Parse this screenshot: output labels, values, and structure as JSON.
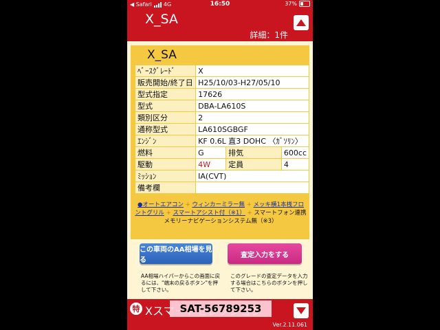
{
  "status_bar": {
    "carrier": "◀ Safari",
    "network": "4G",
    "time": "16:50",
    "battery": "37%"
  },
  "header": {
    "title": "X_SA",
    "detail": "詳細：1件",
    "accent_color": "#c8151f"
  },
  "card": {
    "title": "X_SA",
    "rows": [
      {
        "label": "ﾍﾞｰｽｸﾞﾚｰﾄﾞ",
        "value": "X"
      },
      {
        "label": "販売開始/終了日",
        "value": "H25/10/03-H27/05/10"
      },
      {
        "label": "型式指定",
        "value": "17626"
      },
      {
        "label": "型式",
        "value": "DBA-LA610S"
      },
      {
        "label": "類別区分",
        "value": "2"
      },
      {
        "label": "通称型式",
        "value": "LA610SGBGF"
      },
      {
        "label": "ｴﾝｼﾞﾝ",
        "value": "KF 0.6L 直3 DOHC 〈ｶﾞｿﾘﾝ〉"
      }
    ],
    "fuel": {
      "label": "燃料",
      "value": "G",
      "label2": "排気",
      "value2": "600cc"
    },
    "drive": {
      "label": "駆動",
      "value": "4W",
      "label2": "定員",
      "value2": "4"
    },
    "mission": {
      "label": "ﾐｯｼｮﾝ",
      "value": "IA(CVT)"
    },
    "remarks": {
      "label": "備考欄",
      "value": ""
    },
    "options": {
      "o1": "●オートエアコン",
      "o2": "ウィンカーミラー無",
      "o3": "メッキ横1本桟フロントグリル",
      "o4": "スマートアシスト付（※1）",
      "o5": "スマートフォン連携メモリーナビゲーションシステム無（※3）",
      "plus": "+"
    }
  },
  "buttons": {
    "aa_market": "この車両のAA相場を見る",
    "appraisal": "査定入力をする"
  },
  "notes": {
    "left": "AA相場ハイパーからこの画面に戻るには、\"端末の戻るボタン\"を押して下さい。",
    "right": "このグレードの査定データを入力する場合はこちらのボタンを押して下さい。"
  },
  "footer": {
    "badge": "特",
    "text": "Xスマートセレクション",
    "overlay": "SAT-56789253",
    "version": "Ver.2.11.061"
  }
}
